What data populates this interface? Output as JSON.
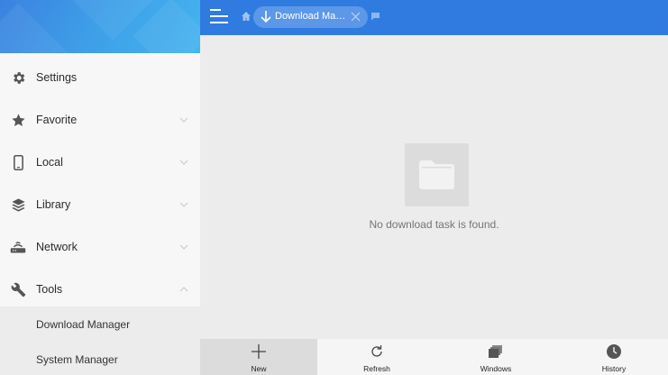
{
  "sidebar": {
    "items": [
      {
        "label": "Settings",
        "icon": "gear-icon"
      },
      {
        "label": "Favorite",
        "icon": "star-icon"
      },
      {
        "label": "Local",
        "icon": "phone-icon"
      },
      {
        "label": "Library",
        "icon": "layers-icon"
      },
      {
        "label": "Network",
        "icon": "router-icon"
      },
      {
        "label": "Tools",
        "icon": "wrench-icon"
      }
    ],
    "sub_items": [
      {
        "label": "Download Manager"
      },
      {
        "label": "System Manager"
      }
    ]
  },
  "topbar": {
    "tab_label": "Download Ma…",
    "accent": "#2f7be0"
  },
  "main": {
    "empty_message": "No download task is found."
  },
  "bottombar": {
    "buttons": [
      {
        "label": "New",
        "icon": "plus-icon"
      },
      {
        "label": "Refresh",
        "icon": "refresh-icon"
      },
      {
        "label": "Windows",
        "icon": "windows-icon"
      },
      {
        "label": "History",
        "icon": "clock-icon"
      }
    ]
  }
}
